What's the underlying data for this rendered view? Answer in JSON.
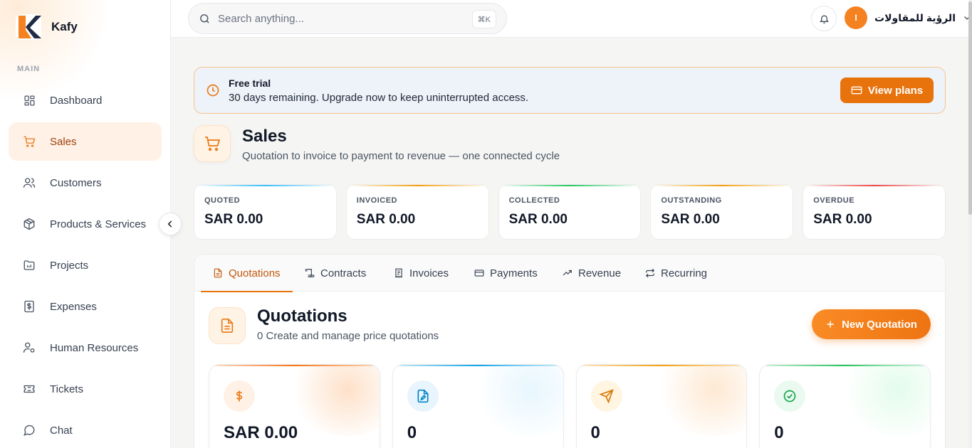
{
  "brand": {
    "name": "Kafy"
  },
  "sidebar": {
    "section_label": "MAIN",
    "items": [
      {
        "label": "Dashboard",
        "icon": "dashboard-icon"
      },
      {
        "label": "Sales",
        "icon": "cart-icon",
        "active": true
      },
      {
        "label": "Customers",
        "icon": "users-icon"
      },
      {
        "label": "Products & Services",
        "icon": "box-icon"
      },
      {
        "label": "Projects",
        "icon": "folder-icon"
      },
      {
        "label": "Expenses",
        "icon": "dollar-icon"
      },
      {
        "label": "Human Resources",
        "icon": "user-gear-icon"
      },
      {
        "label": "Tickets",
        "icon": "ticket-icon"
      },
      {
        "label": "Chat",
        "icon": "chat-icon"
      }
    ]
  },
  "topbar": {
    "search_placeholder": "Search anything...",
    "search_shortcut": "⌘K",
    "user_initial": "I",
    "user_name": "الرؤية للمقاولات"
  },
  "trial": {
    "title": "Free trial",
    "text": "30 days remaining. Upgrade now to keep uninterrupted access.",
    "button": "View plans"
  },
  "page": {
    "title": "Sales",
    "subtitle": "Quotation to invoice to payment to revenue — one connected cycle"
  },
  "stats": [
    {
      "label": "QUOTED",
      "value": "SAR 0.00",
      "color": "#38bdf8"
    },
    {
      "label": "INVOICED",
      "value": "SAR 0.00",
      "color": "#f59e0b"
    },
    {
      "label": "COLLECTED",
      "value": "SAR 0.00",
      "color": "#22c55e"
    },
    {
      "label": "OUTSTANDING",
      "value": "SAR 0.00",
      "color": "#f59e0b"
    },
    {
      "label": "OVERDUE",
      "value": "SAR 0.00",
      "color": "#ef4444"
    }
  ],
  "tabs": [
    {
      "label": "Quotations",
      "icon": "document-icon",
      "active": true
    },
    {
      "label": "Contracts",
      "icon": "scroll-icon"
    },
    {
      "label": "Invoices",
      "icon": "receipt-icon"
    },
    {
      "label": "Payments",
      "icon": "card-icon"
    },
    {
      "label": "Revenue",
      "icon": "trend-icon"
    },
    {
      "label": "Recurring",
      "icon": "repeat-icon"
    }
  ],
  "quotations": {
    "title": "Quotations",
    "subtitle": "0 Create and manage price quotations",
    "new_button": "New Quotation"
  },
  "kpis": [
    {
      "value": "SAR 0.00",
      "icon": "dollar-icon",
      "color": "#f97316"
    },
    {
      "value": "0",
      "icon": "file-edit-icon",
      "color": "#0ea5e9"
    },
    {
      "value": "0",
      "icon": "send-icon",
      "color": "#f59e0b"
    },
    {
      "value": "0",
      "icon": "check-circle-icon",
      "color": "#22c55e"
    }
  ]
}
